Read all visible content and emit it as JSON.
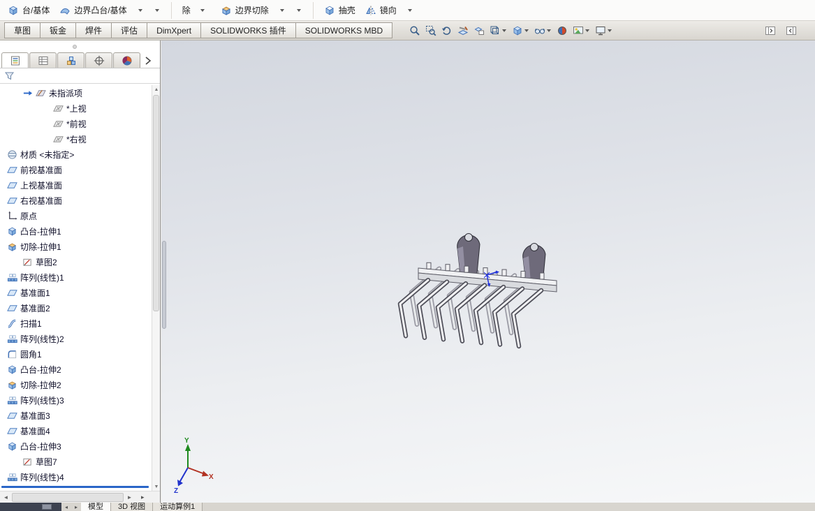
{
  "ribbon": {
    "buttons": [
      {
        "label": "台/基体",
        "icon": "loft-boss-icon"
      },
      {
        "label": "边界凸台/基体",
        "icon": "boundary-boss-icon"
      },
      {
        "label": "除",
        "icon": "",
        "caret": true
      },
      {
        "label": "边界切除",
        "icon": "boundary-cut-icon"
      },
      {
        "label": "抽壳",
        "icon": "shell-icon"
      },
      {
        "label": "镜向",
        "icon": "mirror-icon"
      }
    ]
  },
  "command_tabs": [
    "草图",
    "钣金",
    "焊件",
    "评估",
    "DimXpert",
    "SOLIDWORKS 插件",
    "SOLIDWORKS MBD"
  ],
  "headsup": [
    {
      "name": "zoom-to-fit-icon",
      "caret": false
    },
    {
      "name": "zoom-to-area-icon",
      "caret": false
    },
    {
      "name": "previous-view-icon",
      "caret": false
    },
    {
      "name": "section-view-icon",
      "caret": false
    },
    {
      "name": "dynamic-annotation-icon",
      "caret": false
    },
    {
      "name": "view-orientation-icon",
      "caret": true
    },
    {
      "name": "display-style-icon",
      "caret": true
    },
    {
      "name": "hide-show-items-icon",
      "caret": true
    },
    {
      "name": "edit-appearance-icon",
      "caret": false
    },
    {
      "name": "apply-scene-icon",
      "caret": true
    },
    {
      "name": "view-settings-icon",
      "caret": true
    }
  ],
  "panel_toggles": [
    "collapse-left-pane-icon",
    "collapse-right-pane-icon"
  ],
  "manager_tabs": [
    {
      "name": "feature-manager-tab",
      "icon": "feature-manager-icon",
      "active": true
    },
    {
      "name": "property-manager-tab",
      "icon": "property-manager-icon",
      "active": false
    },
    {
      "name": "configuration-manager-tab",
      "icon": "configuration-manager-icon",
      "active": false
    },
    {
      "name": "dimxpert-manager-tab",
      "icon": "dimxpert-manager-icon",
      "active": false
    },
    {
      "name": "display-manager-tab",
      "icon": "display-manager-icon",
      "active": false
    }
  ],
  "feature_tree": {
    "items": [
      {
        "label": "未指派项",
        "icon": "annotation-plane-icon",
        "indent": 3,
        "rollback_arrow": true
      },
      {
        "label": "*上视",
        "icon": "view-plane-icon",
        "indent": 4
      },
      {
        "label": "*前视",
        "icon": "view-plane-icon",
        "indent": 4
      },
      {
        "label": "*右视",
        "icon": "view-plane-icon",
        "indent": 4
      },
      {
        "label": "材质 <未指定>",
        "icon": "material-icon",
        "indent": 1
      },
      {
        "label": "前视基准面",
        "icon": "plane-icon",
        "indent": 1
      },
      {
        "label": "上视基准面",
        "icon": "plane-icon",
        "indent": 1
      },
      {
        "label": "右视基准面",
        "icon": "plane-icon",
        "indent": 1
      },
      {
        "label": "原点",
        "icon": "origin-icon",
        "indent": 1
      },
      {
        "label": "凸台-拉伸1",
        "icon": "boss-extrude-icon",
        "indent": 1
      },
      {
        "label": "切除-拉伸1",
        "icon": "cut-extrude-icon",
        "indent": 1
      },
      {
        "label": "草图2",
        "icon": "sketch-icon",
        "indent": 2
      },
      {
        "label": "阵列(线性)1",
        "icon": "linear-pattern-icon",
        "indent": 1
      },
      {
        "label": "基准面1",
        "icon": "plane-icon",
        "indent": 1
      },
      {
        "label": "基准面2",
        "icon": "plane-icon",
        "indent": 1
      },
      {
        "label": "扫描1",
        "icon": "sweep-icon",
        "indent": 1
      },
      {
        "label": "阵列(线性)2",
        "icon": "linear-pattern-icon",
        "indent": 1
      },
      {
        "label": "圆角1",
        "icon": "fillet-icon",
        "indent": 1
      },
      {
        "label": "凸台-拉伸2",
        "icon": "boss-extrude-icon",
        "indent": 1
      },
      {
        "label": "切除-拉伸2",
        "icon": "cut-extrude-icon",
        "indent": 1
      },
      {
        "label": "阵列(线性)3",
        "icon": "linear-pattern-icon",
        "indent": 1
      },
      {
        "label": "基准面3",
        "icon": "plane-icon",
        "indent": 1
      },
      {
        "label": "基准面4",
        "icon": "plane-icon",
        "indent": 1
      },
      {
        "label": "凸台-拉伸3",
        "icon": "boss-extrude-icon",
        "indent": 1
      },
      {
        "label": "草图7",
        "icon": "sketch-icon",
        "indent": 2
      },
      {
        "label": "阵列(线性)4",
        "icon": "linear-pattern-icon",
        "indent": 1
      }
    ]
  },
  "triad": {
    "x": "X",
    "y": "Y",
    "z": "Z",
    "x_color": "#b23222",
    "y_color": "#1f8a1f",
    "z_color": "#2233cc"
  },
  "status_bar": {
    "tabs": [
      {
        "label": "模型",
        "active": true
      },
      {
        "label": "3D 视图",
        "active": false
      },
      {
        "label": "运动算例1",
        "active": false
      }
    ]
  }
}
